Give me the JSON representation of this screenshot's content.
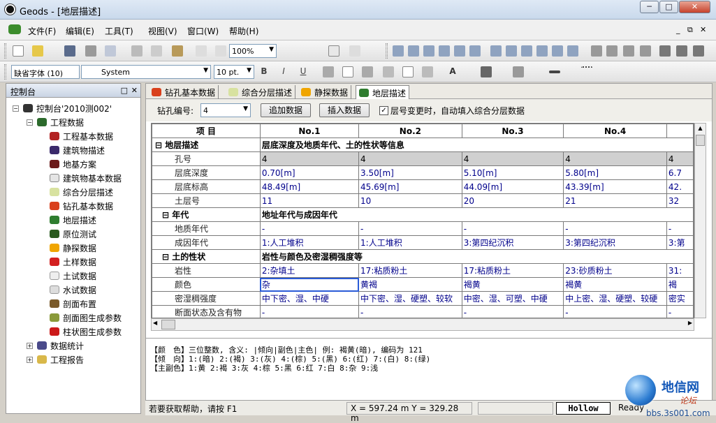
{
  "window": {
    "title": "Geods - [地层描述]"
  },
  "menu": [
    "文件(F)",
    "编辑(E)",
    "工具(T)",
    "视图(V)",
    "窗口(W)",
    "帮助(H)"
  ],
  "toolbar": {
    "zoom": "100%"
  },
  "format_toolbar": {
    "script": "缺省字体 (10)",
    "font": "System",
    "size": "10 pt."
  },
  "panel": {
    "title": "控制台",
    "root": "控制台'2010测002'",
    "group": "工程数据",
    "items": [
      "工程基本数据",
      "建筑物描述",
      "地基方案",
      "建筑物基本数据",
      "综合分层描述",
      "钻孔基本数据",
      "地层描述",
      "原位测试",
      "静探数据",
      "土样数据",
      "土试数据",
      "水试数据",
      "剖面布置",
      "剖面图生成参数",
      "柱状图生成参数"
    ],
    "stats": "数据统计",
    "report": "工程报告"
  },
  "tabs": [
    "钻孔基本数据",
    "综合分层描述",
    "静探数据",
    "地层描述"
  ],
  "form": {
    "borehole_label": "钻孔编号:",
    "borehole_value": "4",
    "add_btn": "追加数据",
    "insert_btn": "插入数据",
    "auto_label": "层号变更时，自动填入综合分层数据"
  },
  "grid": {
    "headers": [
      "项  目",
      "No.1",
      "No.2",
      "No.3",
      "No.4",
      ""
    ],
    "rows": [
      {
        "type": "sec",
        "name": "⊟ 地层描述",
        "text": "层底深度及地质年代、土的性状等信息"
      },
      {
        "type": "data",
        "name": "孔号",
        "vals": [
          "4",
          "4",
          "4",
          "4",
          "4"
        ],
        "grey": true
      },
      {
        "type": "data",
        "name": "层底深度",
        "vals": [
          "0.70[m]",
          "3.50[m]",
          "5.10[m]",
          "5.80[m]",
          "6.7"
        ]
      },
      {
        "type": "data",
        "name": "层底标高",
        "vals": [
          "48.49[m]",
          "45.69[m]",
          "44.09[m]",
          "43.39[m]",
          "42."
        ]
      },
      {
        "type": "data",
        "name": "土层号",
        "vals": [
          "11",
          "10",
          "20",
          "21",
          "32"
        ]
      },
      {
        "type": "sec",
        "name": "⊟ 年代",
        "text": "地址年代与成因年代"
      },
      {
        "type": "data",
        "name": "地质年代",
        "vals": [
          "-",
          "-",
          "-",
          "-",
          "-"
        ]
      },
      {
        "type": "data",
        "name": "成因年代",
        "vals": [
          "1:人工堆积",
          "1:人工堆积",
          "3:第四纪沉积",
          "3:第四纪沉积",
          "3:第"
        ]
      },
      {
        "type": "sec",
        "name": "⊟ 土的性状",
        "text": "岩性与颜色及密湿稠强度等"
      },
      {
        "type": "data",
        "name": "岩性",
        "vals": [
          "2:杂填土",
          "17:粘质粉土",
          "17:粘质粉土",
          "23:砂质粉土",
          "31:"
        ]
      },
      {
        "type": "data",
        "name": "颜色",
        "vals": [
          "杂",
          "黄褐",
          "褐黄",
          "褐黄",
          "褐"
        ],
        "sel": true
      },
      {
        "type": "data",
        "name": "密湿稠强度",
        "vals": [
          "中下密、湿、中硬",
          "中下密、湿、硬塑、较软",
          "中密、湿、可塑、中硬",
          "中上密、湿、硬塑、较硬",
          "密实"
        ]
      },
      {
        "type": "data",
        "name": "断面状态及含有物",
        "vals": [
          "-",
          "-",
          "-",
          "-",
          "-"
        ]
      }
    ]
  },
  "notes": [
    "【颜　色】三位整数, 含义: |倾向|副色|主色|  例: 褐黄(暗), 编码为 121",
    "【倾　向】1:(暗) 2:(褐) 3:(灰) 4:(棕) 5:(黑) 6:(红) 7:(白) 8:(绿)",
    "【主副色】1:黄   2:褐  3:灰   4:棕   5:黑   6:红   7:白   8:杂   9:浅"
  ],
  "status": {
    "help": "若要获取帮助，请按 F1",
    "coords": "X = 597.24 m  Y = 329.28 m",
    "mode": "Hollow",
    "ready": "Ready"
  },
  "watermark": {
    "brand": "地信网",
    "sub": "论坛",
    "url": "bbs.3s001.com"
  },
  "colors": {
    "accent": "#00008b",
    "grid_line": "#7a7a7a"
  }
}
